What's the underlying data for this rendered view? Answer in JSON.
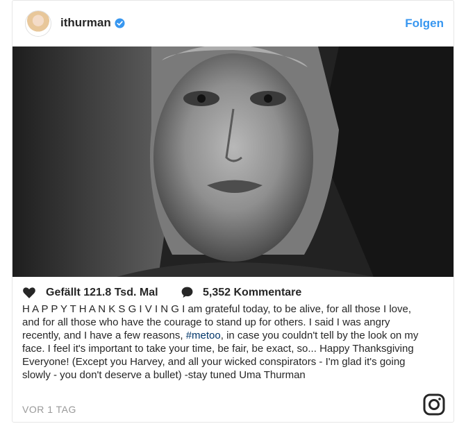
{
  "header": {
    "username": "ithurman",
    "verified_icon": "verified-badge-icon",
    "follow_label": "Folgen",
    "accent_color": "#3897f0"
  },
  "post": {
    "image_alt": "black-and-white portrait photo",
    "likes_label": "Gefällt 121.8 Tsd. Mal",
    "comments_label": "5,352 Kommentare",
    "caption_before_tag": "H A P P Y T H A N K S G I V I N G I am grateful today, to be alive, for all those I love, and for all those who have the courage to stand up for others. I said I was angry recently, and I have a few reasons, ",
    "hashtag": "#metoo",
    "caption_after_tag": ", in case you couldn't tell by the look on my face. I feel it's important to take your time, be fair, be exact, so... Happy Thanksgiving Everyone! (Except you Harvey, and all your wicked conspirators - I'm glad it's going slowly - you don't deserve a bullet) -stay tuned Uma Thurman",
    "timestamp": "VOR 1 TAG"
  },
  "icons": {
    "like": "heart-icon",
    "comment": "comment-bubble-icon",
    "brand": "instagram-logo-icon"
  }
}
